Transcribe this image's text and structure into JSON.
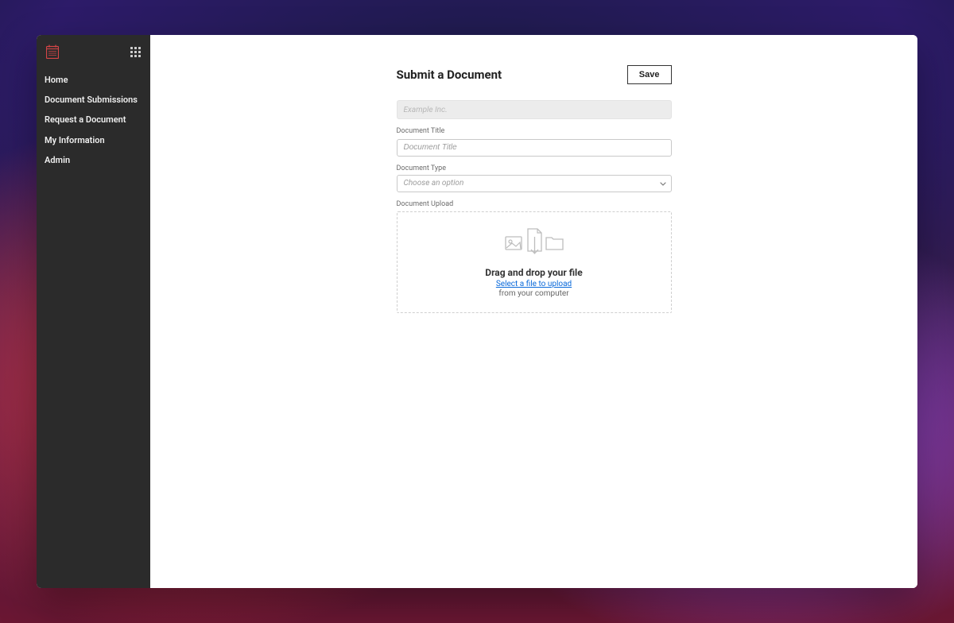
{
  "sidebar": {
    "items": [
      {
        "label": "Home"
      },
      {
        "label": "Document Submissions"
      },
      {
        "label": "Request a Document"
      },
      {
        "label": "My Information"
      },
      {
        "label": "Admin"
      }
    ]
  },
  "page": {
    "title": "Submit a Document",
    "save_label": "Save"
  },
  "form": {
    "company": {
      "value": "Example Inc."
    },
    "document_title": {
      "label": "Document Title",
      "placeholder": "Document Title"
    },
    "document_type": {
      "label": "Document Type",
      "placeholder": "Choose an option"
    },
    "upload": {
      "label": "Document Upload",
      "drop_title": "Drag and drop your file",
      "select_link": "Select a file to upload",
      "subtext": "from your computer"
    }
  }
}
